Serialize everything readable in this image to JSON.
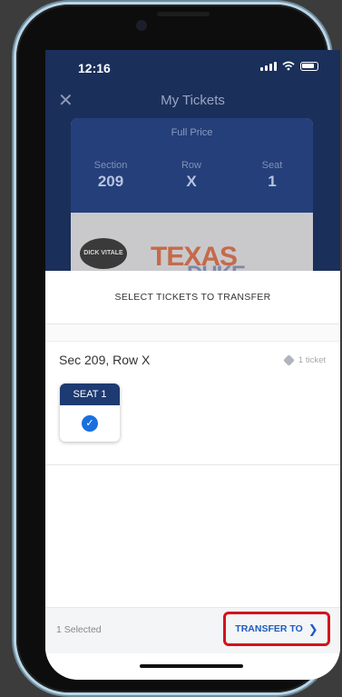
{
  "status_bar": {
    "time": "12:16"
  },
  "header": {
    "title": "My Tickets",
    "close_icon": "close-icon"
  },
  "ticket": {
    "price_type": "Full Price",
    "section_label": "Section",
    "section_value": "209",
    "row_label": "Row",
    "row_value": "X",
    "seat_label": "Seat",
    "seat_value": "1",
    "event_logo_text": "DICK VITALE",
    "event_name_line1": "TEXAS",
    "event_name_line2": "DUKE"
  },
  "transfer_sheet": {
    "title": "SELECT TICKETS TO TRANSFER",
    "group_label": "Sec 209, Row X",
    "ticket_count": "1 ticket",
    "seats": [
      {
        "label": "SEAT 1",
        "selected": true
      }
    ],
    "selected_count": "1 Selected",
    "transfer_label": "TRANSFER TO"
  },
  "colors": {
    "navy": "#1d3a72",
    "accent_blue": "#1a6fe0",
    "link_blue": "#1e5bbf",
    "highlight_red": "#d3141b"
  }
}
